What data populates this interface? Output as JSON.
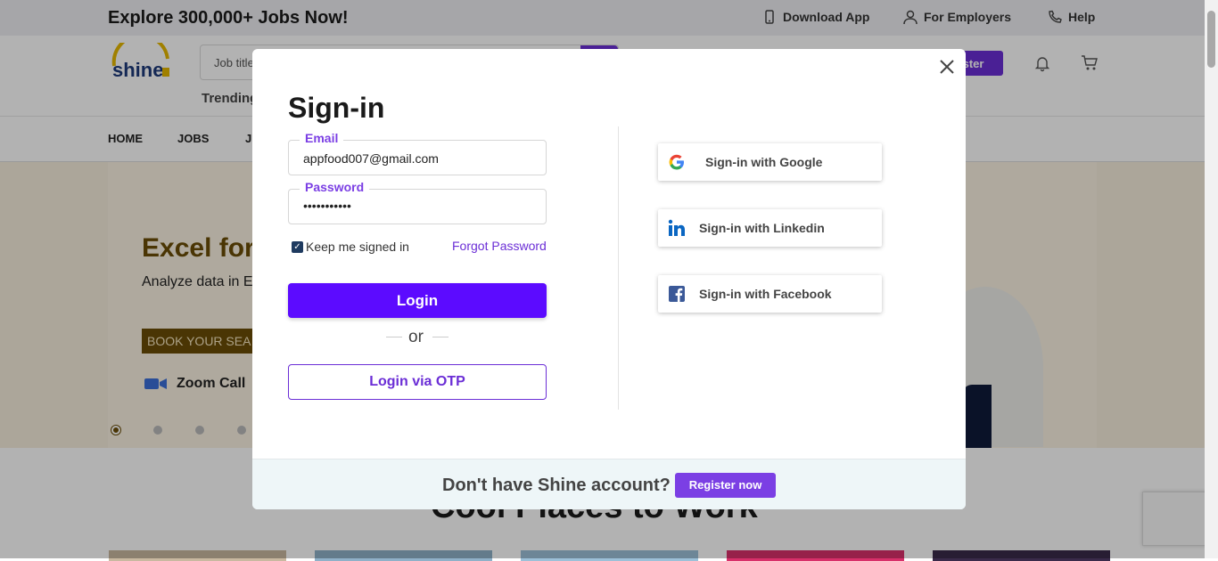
{
  "topbar": {
    "promo": "Explore 300,000+ Jobs Now!",
    "download_app": "Download App",
    "for_employers": "For Employers",
    "help": "Help"
  },
  "header": {
    "logo_text": "shine",
    "search_placeholder": "Job title",
    "trending": "Trending",
    "register_partial": "ister",
    "bell_icon": "bell-icon",
    "cart_icon": "cart-icon"
  },
  "nav": {
    "items": [
      "HOME",
      "JOBS",
      "J"
    ]
  },
  "hero": {
    "title_partial": "Excel for",
    "subtitle_partial": "Analyze data in E",
    "book_partial": "BOOK YOUR SEA",
    "zoom": "Zoom Call",
    "active_slide": 1,
    "slide_count": 4
  },
  "section": {
    "title_partial": "Cool Places to Work"
  },
  "modal": {
    "title": "Sign-in",
    "email_label": "Email",
    "email_value": "appfood007@gmail.com",
    "password_label": "Password",
    "password_value": "•••••••••••",
    "keep_signed_in": "Keep me signed in",
    "keep_checked": true,
    "forgot_password": "Forgot Password",
    "login_button": "Login",
    "or_text": "or",
    "otp_button": "Login via OTP",
    "social": {
      "google": "Sign-in with Google",
      "linkedin": "Sign-in with Linkedin",
      "facebook": "Sign-in with Facebook"
    },
    "footer_text": "Don't have Shine account?",
    "register_now": "Register now"
  },
  "colors": {
    "brand_purple": "#6b2ed6",
    "login_button": "#5c0bff",
    "hero_brown": "#6a4d06"
  }
}
